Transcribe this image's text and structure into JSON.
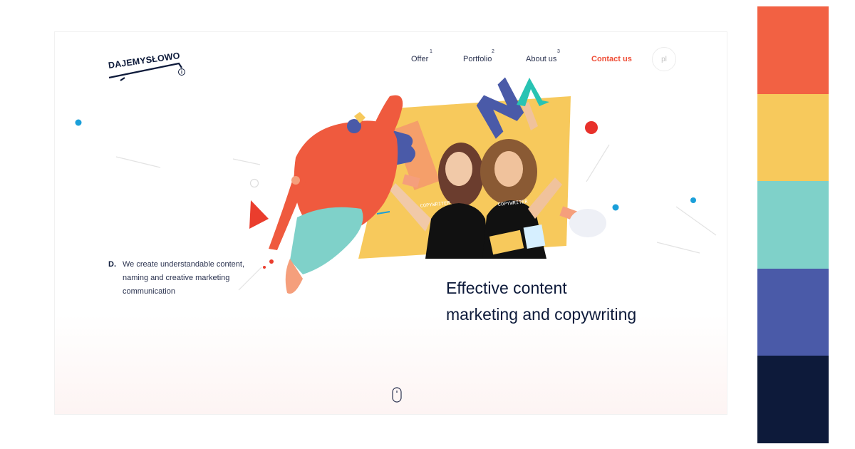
{
  "logo": {
    "text": "DAJEMYSŁOWO"
  },
  "nav": {
    "items": [
      {
        "label": "Offer",
        "num": "1"
      },
      {
        "label": "Portfolio",
        "num": "2"
      },
      {
        "label": "About us",
        "num": "3"
      }
    ],
    "contact_label": "Contact us",
    "lang_label": "pl"
  },
  "hero": {
    "tag_letter": "D.",
    "tagline": "We create understandable content, naming and creative marketing communication",
    "headline_line1": "Effective content",
    "headline_line2": "marketing and copywriting",
    "shirt_text": "COPYWRITER"
  },
  "colors": {
    "accent": "#ef4d36",
    "palette": [
      "#f26143",
      "#f7c95c",
      "#7fd1c9",
      "#4a5aa8",
      "#0d1a3a"
    ]
  },
  "icons": {
    "scroll": "mouse-icon",
    "info": "info-icon"
  }
}
